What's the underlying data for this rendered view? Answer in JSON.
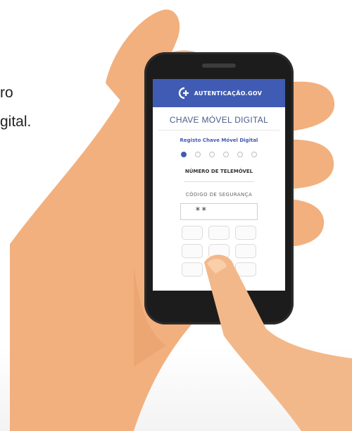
{
  "side_text": {
    "line1": "ro",
    "line2": "gital."
  },
  "app": {
    "brand": "AUTENTICAÇÃO.GOV",
    "logo_icon": "plus-c-logo-icon",
    "title": "CHAVE MÓVEL DIGITAL",
    "subtitle": "Registo Chave Móvel Digital",
    "steps": {
      "total": 6,
      "active": 1
    },
    "phone_label": "NÚMERO DE TELEMÓVEL",
    "code_label": "CÓDIGO DE SEGURANÇA",
    "code_value": "**",
    "keypad_keys": 9
  },
  "colors": {
    "accent": "#3f5bb3",
    "skin": "#f2b07e",
    "phone_body": "#1c1c1c"
  }
}
